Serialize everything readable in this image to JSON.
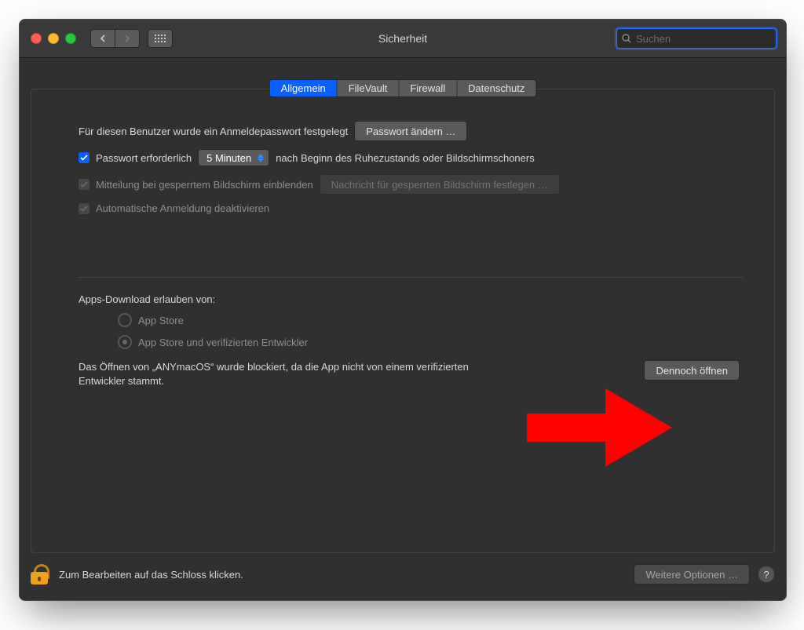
{
  "window": {
    "title": "Sicherheit",
    "search_placeholder": "Suchen"
  },
  "tabs": [
    "Allgemein",
    "FileVault",
    "Firewall",
    "Datenschutz"
  ],
  "general": {
    "login_password_set": "Für diesen Benutzer wurde ein Anmeldepasswort festgelegt",
    "change_password_btn": "Passwort ändern …",
    "require_password": {
      "label": "Passwort erforderlich",
      "delay": "5 Minuten",
      "suffix": "nach Beginn des Ruhezustands oder Bildschirmschoners"
    },
    "show_lock_message": "Mitteilung bei gesperrtem Bildschirm einblenden",
    "set_lock_message_btn": "Nachricht für gesperrten Bildschirm festlegen …",
    "disable_autologin": "Automatische Anmeldung deaktivieren",
    "allow_apps": {
      "heading": "Apps-Download erlauben von:",
      "options": [
        "App Store",
        "App Store und verifizierten Entwickler"
      ]
    },
    "blocked_app_message": "Das Öffnen von „ANYmacOS“ wurde blockiert, da die App nicht von einem verifizierten Entwickler stammt.",
    "open_anyway_btn": "Dennoch öffnen"
  },
  "footer": {
    "lock_hint": "Zum Bearbeiten auf das Schloss klicken.",
    "more_options_btn": "Weitere Optionen …"
  }
}
